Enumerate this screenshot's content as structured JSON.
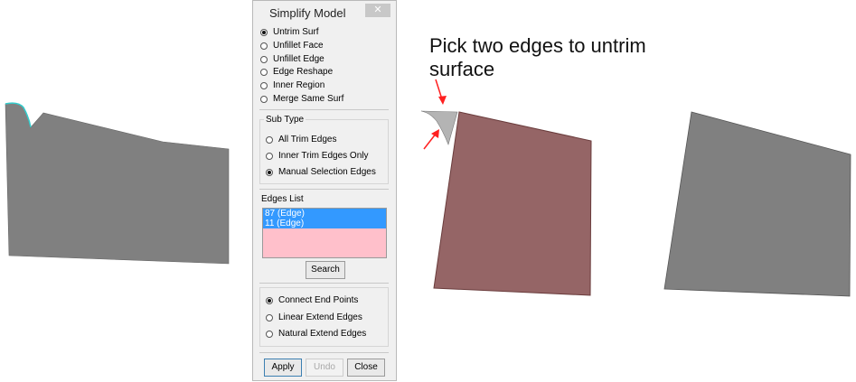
{
  "dialog": {
    "title": "Simplify Model",
    "close_label": "✕",
    "modes": [
      {
        "label": "Untrim Surf",
        "selected": true
      },
      {
        "label": "Unfillet Face",
        "selected": false
      },
      {
        "label": "Unfillet Edge",
        "selected": false
      },
      {
        "label": "Edge Reshape",
        "selected": false
      },
      {
        "label": "Inner Region",
        "selected": false
      },
      {
        "label": "Merge Same Surf",
        "selected": false
      }
    ],
    "sub_type": {
      "title": "Sub Type",
      "options": [
        {
          "label": "All Trim Edges",
          "selected": false
        },
        {
          "label": "Inner Trim Edges Only",
          "selected": false
        },
        {
          "label": "Manual Selection Edges",
          "selected": true
        }
      ]
    },
    "edges_list": {
      "title": "Edges List",
      "items": [
        "87 (Edge)",
        "11 (Edge)"
      ]
    },
    "search_label": "Search",
    "extend_options": [
      {
        "label": "Connect End Points",
        "selected": true
      },
      {
        "label": "Linear Extend Edges",
        "selected": false
      },
      {
        "label": "Natural Extend Edges",
        "selected": false
      }
    ],
    "buttons": {
      "apply": "Apply",
      "undo": "Undo",
      "close": "Close"
    }
  },
  "annotation": {
    "line1": "Pick two edges to untrim",
    "line2": "surface"
  },
  "colors": {
    "surface_gray": "#808080",
    "surface_selected": "#956566",
    "trim_fillet": "#b4b4b4",
    "arrow": "#ff2020",
    "highlight_edge": "#33cccc",
    "list_highlight": "#3399ff",
    "list_background": "#ffc0cb"
  }
}
